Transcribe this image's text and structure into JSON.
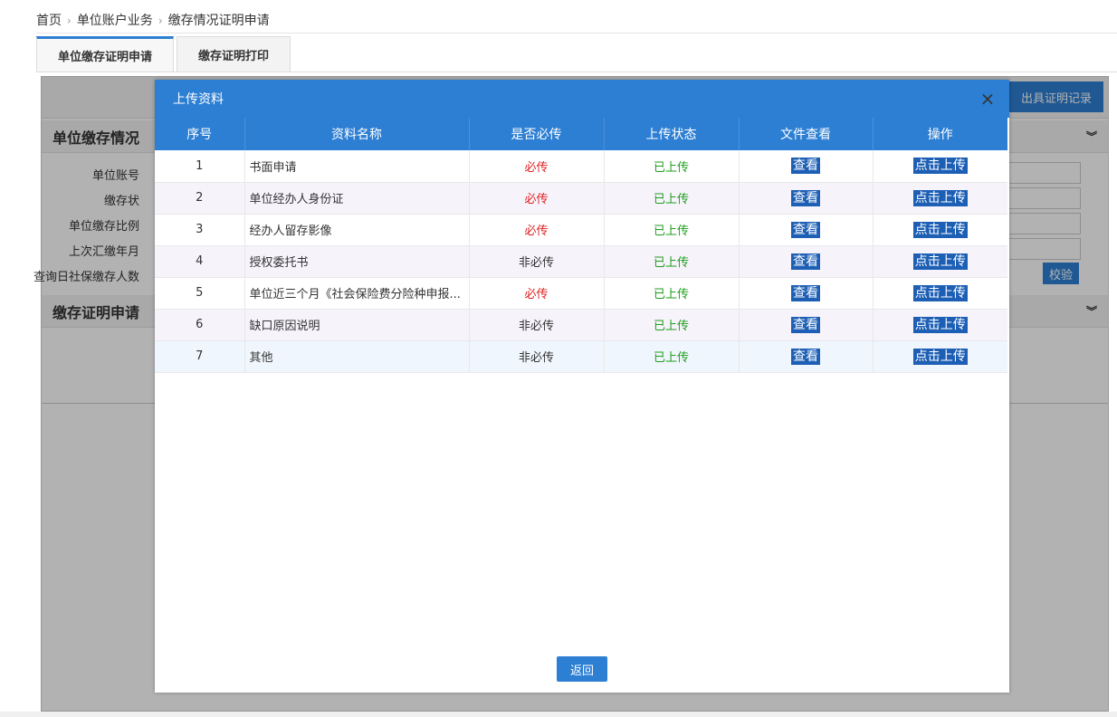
{
  "breadcrumb": [
    "首页",
    "单位账户业务",
    "缴存情况证明申请"
  ],
  "tabs": [
    {
      "label": "单位缴存证明申请",
      "active": true
    },
    {
      "label": "缴存证明打印",
      "active": false
    }
  ],
  "background": {
    "record_button": "出具证明记录",
    "section1_title": "单位缴存情况",
    "section2_title": "缴存证明申请",
    "form_labels": [
      "单位账号",
      "缴存状",
      "单位缴存比例",
      "上次汇缴年月",
      "查询日社保缴存人数"
    ],
    "check_button": "校验",
    "chevron": "»"
  },
  "modal": {
    "title": "上传资料",
    "close_icon": "×",
    "columns": [
      "序号",
      "资料名称",
      "是否必传",
      "上传状态",
      "文件查看",
      "操作"
    ],
    "rows": [
      {
        "no": "1",
        "name": "书面申请",
        "required": "必传",
        "is_required": true,
        "status": "已上传",
        "view": "查看",
        "action": "点击上传"
      },
      {
        "no": "2",
        "name": "单位经办人身份证",
        "required": "必传",
        "is_required": true,
        "status": "已上传",
        "view": "查看",
        "action": "点击上传"
      },
      {
        "no": "3",
        "name": "经办人留存影像",
        "required": "必传",
        "is_required": true,
        "status": "已上传",
        "view": "查看",
        "action": "点击上传"
      },
      {
        "no": "4",
        "name": "授权委托书",
        "required": "非必传",
        "is_required": false,
        "status": "已上传",
        "view": "查看",
        "action": "点击上传"
      },
      {
        "no": "5",
        "name": "单位近三个月《社会保险费分险种申报...",
        "required": "必传",
        "is_required": true,
        "status": "已上传",
        "view": "查看",
        "action": "点击上传"
      },
      {
        "no": "6",
        "name": "缺口原因说明",
        "required": "非必传",
        "is_required": false,
        "status": "已上传",
        "view": "查看",
        "action": "点击上传"
      },
      {
        "no": "7",
        "name": "其他",
        "required": "非必传",
        "is_required": false,
        "status": "已上传",
        "view": "查看",
        "action": "点击上传"
      }
    ],
    "back_button": "返回"
  },
  "colors": {
    "primary": "#2d7fd3",
    "button_dark": "#1c5fb5",
    "required_red": "#e02020",
    "status_green": "#1e9e1e"
  }
}
